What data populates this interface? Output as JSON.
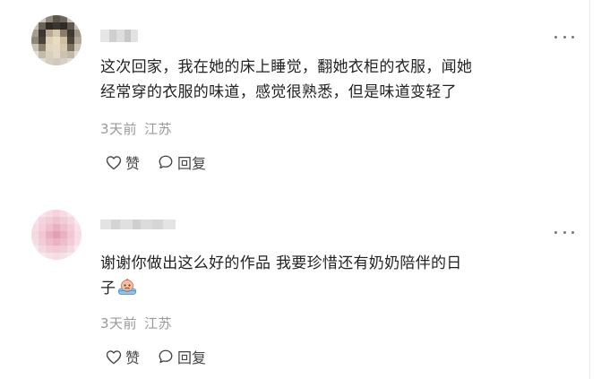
{
  "comments": [
    {
      "text_line1": "这次回家，我在她的床上睡觉，翻她衣柜的衣服，闻她",
      "text_line2": "经常穿的衣服的味道，感觉很熟悉，但是味道变轻了",
      "time": "3天前",
      "location": "江苏",
      "like_label": "赞",
      "reply_label": "回复"
    },
    {
      "text_line1": "谢谢你做出这么好的作品 我要珍惜还有奶奶陪伴的日",
      "text_line2": "子",
      "time": "3天前",
      "location": "江苏",
      "like_label": "赞",
      "reply_label": "回复"
    }
  ],
  "icons": {
    "more": "more-dots-icon",
    "like": "heart-outline-icon",
    "reply": "speech-bubble-icon",
    "emoji": "crying-face-emoji"
  },
  "colors": {
    "text": "#222222",
    "meta": "#999999",
    "icon": "#444444"
  }
}
